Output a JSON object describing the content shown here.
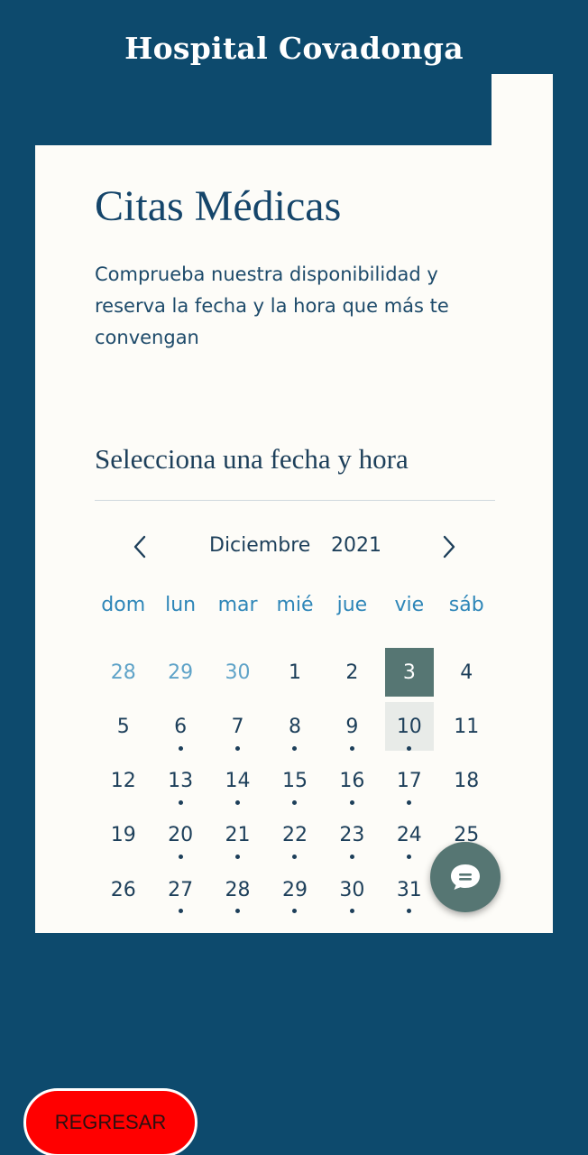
{
  "header": {
    "title": "Hospital Covadonga"
  },
  "card": {
    "title": "Citas Médicas",
    "description": "Comprueba nuestra disponibilidad y reserva la fecha y la hora que más te convengan",
    "section_title": "Selecciona una fecha y hora"
  },
  "calendar": {
    "month": "Diciembre",
    "year": "2021",
    "weekdays": [
      "dom",
      "lun",
      "mar",
      "mié",
      "jue",
      "vie",
      "sáb"
    ],
    "days": [
      {
        "label": "28",
        "other": true,
        "dot": false
      },
      {
        "label": "29",
        "other": true,
        "dot": false
      },
      {
        "label": "30",
        "other": true,
        "dot": false
      },
      {
        "label": "1",
        "other": false,
        "dot": false
      },
      {
        "label": "2",
        "other": false,
        "dot": false
      },
      {
        "label": "3",
        "other": false,
        "dot": false,
        "selected": true
      },
      {
        "label": "4",
        "other": false,
        "dot": false
      },
      {
        "label": "5",
        "other": false,
        "dot": false
      },
      {
        "label": "6",
        "other": false,
        "dot": true
      },
      {
        "label": "7",
        "other": false,
        "dot": true
      },
      {
        "label": "8",
        "other": false,
        "dot": true
      },
      {
        "label": "9",
        "other": false,
        "dot": true
      },
      {
        "label": "10",
        "other": false,
        "dot": true,
        "today": true
      },
      {
        "label": "11",
        "other": false,
        "dot": false
      },
      {
        "label": "12",
        "other": false,
        "dot": false
      },
      {
        "label": "13",
        "other": false,
        "dot": true
      },
      {
        "label": "14",
        "other": false,
        "dot": true
      },
      {
        "label": "15",
        "other": false,
        "dot": true
      },
      {
        "label": "16",
        "other": false,
        "dot": true
      },
      {
        "label": "17",
        "other": false,
        "dot": true
      },
      {
        "label": "18",
        "other": false,
        "dot": false
      },
      {
        "label": "19",
        "other": false,
        "dot": false
      },
      {
        "label": "20",
        "other": false,
        "dot": true
      },
      {
        "label": "21",
        "other": false,
        "dot": true
      },
      {
        "label": "22",
        "other": false,
        "dot": true
      },
      {
        "label": "23",
        "other": false,
        "dot": true
      },
      {
        "label": "24",
        "other": false,
        "dot": true
      },
      {
        "label": "25",
        "other": false,
        "dot": false
      },
      {
        "label": "26",
        "other": false,
        "dot": false
      },
      {
        "label": "27",
        "other": false,
        "dot": true
      },
      {
        "label": "28",
        "other": false,
        "dot": true
      },
      {
        "label": "29",
        "other": false,
        "dot": true
      },
      {
        "label": "30",
        "other": false,
        "dot": true
      },
      {
        "label": "31",
        "other": false,
        "dot": true
      }
    ]
  },
  "icons": {
    "prev": "chevron-left-icon",
    "next": "chevron-right-icon",
    "chat": "chat-icon"
  },
  "footer": {
    "back_label": "REGRESAR"
  },
  "colors": {
    "background": "#0d4a6d",
    "card": "#fdfcf8",
    "accent": "#567673",
    "back_button": "#ff0000"
  }
}
